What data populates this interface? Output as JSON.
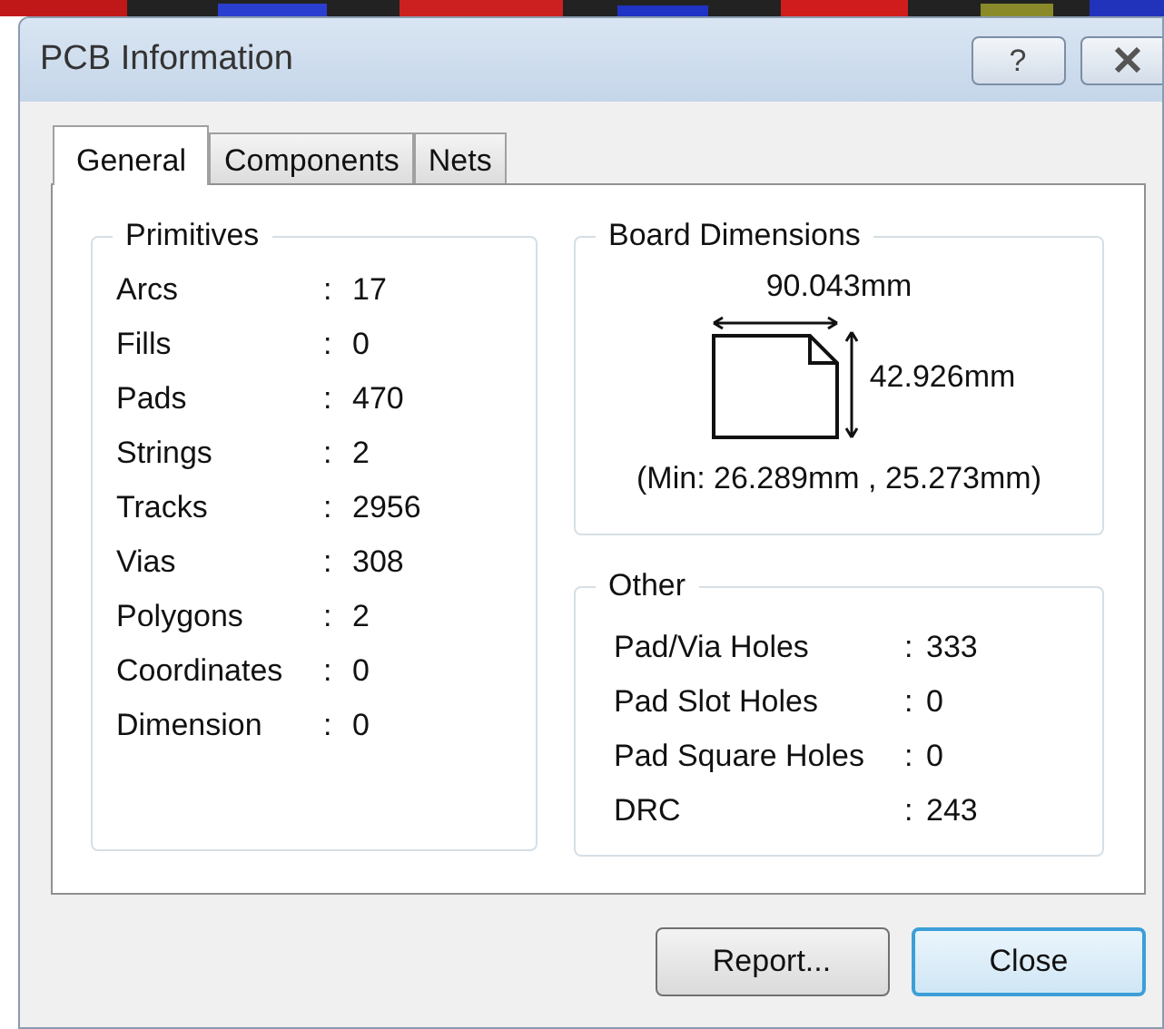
{
  "window": {
    "title": "PCB Information",
    "help": "?"
  },
  "tabs": [
    {
      "label": "General",
      "selected": true
    },
    {
      "label": "Components",
      "selected": false
    },
    {
      "label": "Nets",
      "selected": false
    }
  ],
  "primitives": {
    "title": "Primitives",
    "rows": [
      {
        "label": "Arcs",
        "separator": ":",
        "value": "17"
      },
      {
        "label": "Fills",
        "separator": ":",
        "value": "0"
      },
      {
        "label": "Pads",
        "separator": ":",
        "value": "470"
      },
      {
        "label": "Strings",
        "separator": ":",
        "value": "2"
      },
      {
        "label": "Tracks",
        "separator": ":",
        "value": "2956"
      },
      {
        "label": "Vias",
        "separator": ":",
        "value": "308"
      },
      {
        "label": "Polygons",
        "separator": ":",
        "value": "2"
      },
      {
        "label": "Coordinates",
        "separator": ":",
        "value": "0"
      },
      {
        "label": "Dimension",
        "separator": ":",
        "value": "0"
      }
    ]
  },
  "board_dimensions": {
    "title": "Board Dimensions",
    "width": "90.043mm",
    "height": "42.926mm",
    "minimum": "(Min: 26.289mm , 25.273mm)"
  },
  "other": {
    "title": "Other",
    "rows": [
      {
        "label": "Pad/Via Holes",
        "separator": ":",
        "value": "333"
      },
      {
        "label": "Pad Slot Holes",
        "separator": ":",
        "value": "0"
      },
      {
        "label": "Pad Square Holes",
        "separator": ":",
        "value": "0"
      },
      {
        "label": "DRC",
        "separator": ":",
        "value": "243"
      }
    ]
  },
  "buttons": [
    {
      "label": "Report...",
      "default": false
    },
    {
      "label": "Close",
      "default": true
    }
  ]
}
